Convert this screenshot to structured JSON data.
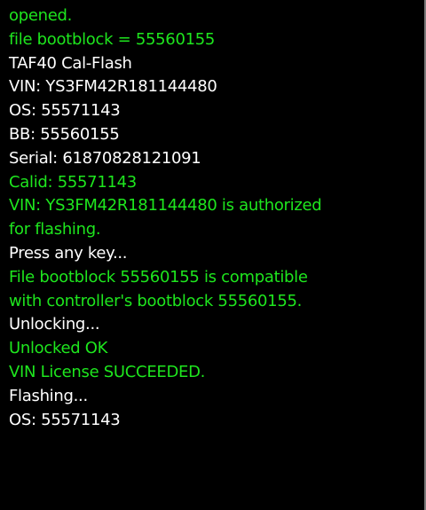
{
  "console": {
    "lines": [
      {
        "text": "opened.",
        "color": "green"
      },
      {
        "text": "file bootblock = 55560155",
        "color": "green"
      },
      {
        "text": "TAF40 Cal-Flash",
        "color": "white"
      },
      {
        "text": "VIN: YS3FM42R181144480",
        "color": "white"
      },
      {
        "text": "OS: 55571143",
        "color": "white"
      },
      {
        "text": "BB: 55560155",
        "color": "white"
      },
      {
        "text": "Serial: 61870828121091",
        "color": "white"
      },
      {
        "text": "Calid: 55571143",
        "color": "green"
      },
      {
        "text": "VIN: YS3FM42R181144480 is authorized",
        "color": "green"
      },
      {
        "text": "for flashing.",
        "color": "green"
      },
      {
        "text": "Press any key...",
        "color": "white"
      },
      {
        "text": "File bootblock 55560155 is compatible",
        "color": "green"
      },
      {
        "text": "with controller's bootblock 55560155.",
        "color": "green"
      },
      {
        "text": "Unlocking...",
        "color": "white"
      },
      {
        "text": "Unlocked OK",
        "color": "green"
      },
      {
        "text": "VIN License SUCCEEDED.",
        "color": "green"
      },
      {
        "text": "Flashing...",
        "color": "white"
      },
      {
        "text": "OS: 55571143",
        "color": "white"
      }
    ]
  },
  "colors": {
    "green": "#1ee61e",
    "white": "#ffffff",
    "background": "#000000"
  }
}
